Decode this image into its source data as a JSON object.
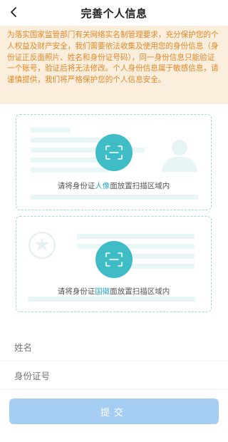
{
  "header": {
    "title": "完善个人信息",
    "back_icon": "chevron-left-icon"
  },
  "notice": {
    "text": "为落实国家监管部门有关网络实名制管理要求，充分保护您的个人权益及财产安全，我们需要依法收集及使用您的身份信息（身份证正反面照片、姓名和身份证号码），同一身份信息只能验证一个账号，验证后将无法修改。个人身份信息属于敏感信息，请谨慎提供，我们将严格保护您的个人信息安全。",
    "color": "#e0892a",
    "background": "#fbeedc"
  },
  "id_front": {
    "hint_prefix": "请将身份证",
    "hint_highlight": "人像",
    "hint_suffix": "面放置扫描区域内",
    "scan_icon": "scan-frame-icon",
    "decor_icon": "person-silhouette-icon"
  },
  "id_back": {
    "hint_prefix": "请将身份证",
    "hint_highlight": "国徽",
    "hint_suffix": "面放置扫描区域内",
    "scan_icon": "scan-frame-icon",
    "decor_icon": "national-emblem-icon"
  },
  "form": {
    "name_placeholder": "姓名",
    "id_number_placeholder": "身份证号"
  },
  "submit": {
    "label": "提交",
    "color": "#a5cdf2"
  },
  "colors": {
    "accent": "#3fbcc6",
    "highlight": "#2fa8c8",
    "card_border": "#9ed8de"
  }
}
